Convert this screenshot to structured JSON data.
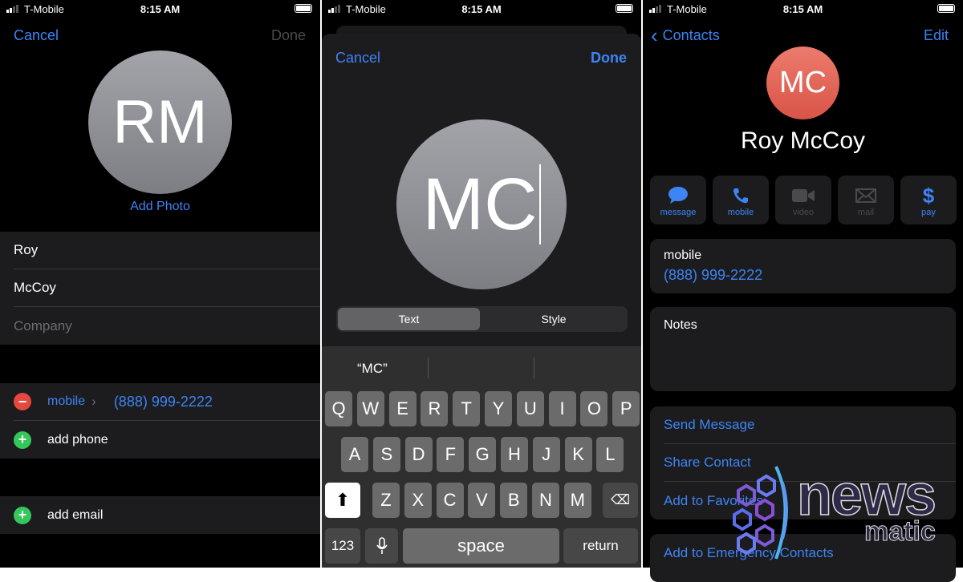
{
  "status_bar": {
    "carrier": "T-Mobile",
    "time": "8:15 AM"
  },
  "panel1": {
    "cancel": "Cancel",
    "done": "Done",
    "initials": "RM",
    "add_photo": "Add Photo",
    "first_name": "Roy",
    "last_name": "McCoy",
    "company_placeholder": "Company",
    "phone_label": "mobile",
    "phone_value": "(888) 999-2222",
    "add_phone": "add phone",
    "add_email": "add email"
  },
  "panel2": {
    "cancel": "Cancel",
    "done": "Done",
    "initials": "MC",
    "segments": [
      "Text",
      "Style"
    ],
    "selected_segment": "Text",
    "suggestion": "“MC”",
    "keyboard": {
      "row1": [
        "Q",
        "W",
        "E",
        "R",
        "T",
        "Y",
        "U",
        "I",
        "O",
        "P"
      ],
      "row2": [
        "A",
        "S",
        "D",
        "F",
        "G",
        "H",
        "J",
        "K",
        "L"
      ],
      "row3": [
        "Z",
        "X",
        "C",
        "V",
        "B",
        "N",
        "M"
      ],
      "numbers": "123",
      "space": "space",
      "return": "return"
    }
  },
  "panel3": {
    "back": "Contacts",
    "edit": "Edit",
    "initials": "MC",
    "name": "Roy McCoy",
    "actions": [
      {
        "label": "message",
        "icon": "message-bubble-icon",
        "enabled": true
      },
      {
        "label": "mobile",
        "icon": "phone-icon",
        "enabled": true
      },
      {
        "label": "video",
        "icon": "video-camera-icon",
        "enabled": false
      },
      {
        "label": "mail",
        "icon": "envelope-icon",
        "enabled": false
      },
      {
        "label": "pay",
        "icon": "dollar-icon",
        "enabled": true
      }
    ],
    "phone_label": "mobile",
    "phone_value": "(888) 999-2222",
    "notes_label": "Notes",
    "menu": [
      "Send Message",
      "Share Contact",
      "Add to Favorites"
    ],
    "emergency": "Add to Emergency Contacts"
  },
  "watermark": {
    "line1": "news",
    "line2": "matic"
  },
  "colors": {
    "accent": "#3d84f5",
    "avatar_red": "#e5675a",
    "avatar_gray": "#8e8e93",
    "remove": "#e5483f",
    "add": "#34c759"
  }
}
